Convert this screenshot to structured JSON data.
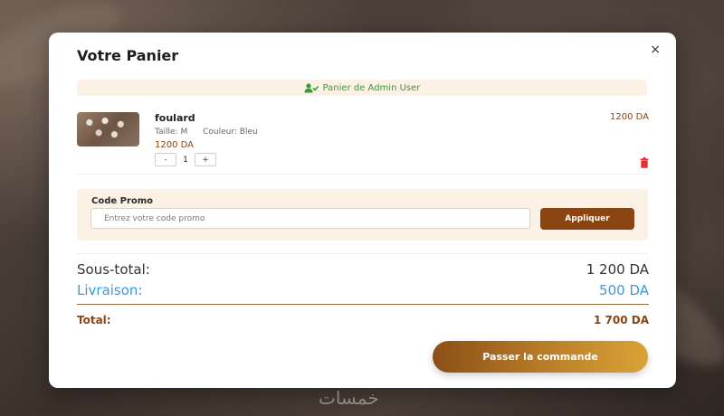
{
  "modal": {
    "title": "Votre Panier",
    "close_icon": "×"
  },
  "owner_banner": {
    "icon": "user-check-icon",
    "text": "Panier de Admin User",
    "color": "#3a9a3a"
  },
  "cart_items": [
    {
      "name": "foulard",
      "size": "Taille: M",
      "color": "Couleur: Bleu",
      "unit_price": "1200 DA",
      "quantity": "1",
      "line_total": "1200 DA",
      "decrement_label": "-",
      "increment_label": "+"
    }
  ],
  "promo": {
    "label": "Code Promo",
    "placeholder": "Entrez votre code promo",
    "apply_label": "Appliquer"
  },
  "summary": {
    "subtotal_label": "Sous-total:",
    "subtotal_value": "1 200 DA",
    "delivery_label": "Livraison:",
    "delivery_value": "500 DA",
    "total_label": "Total:",
    "total_value": "1 700 DA"
  },
  "checkout": {
    "label": "Passer la commande"
  },
  "watermark": {
    "text": "خمسات"
  },
  "colors": {
    "brand_brown": "#8b4513",
    "delivery_blue": "#3a9ad9",
    "trash_red": "#e03030",
    "promo_bg": "#fbf1e4"
  }
}
